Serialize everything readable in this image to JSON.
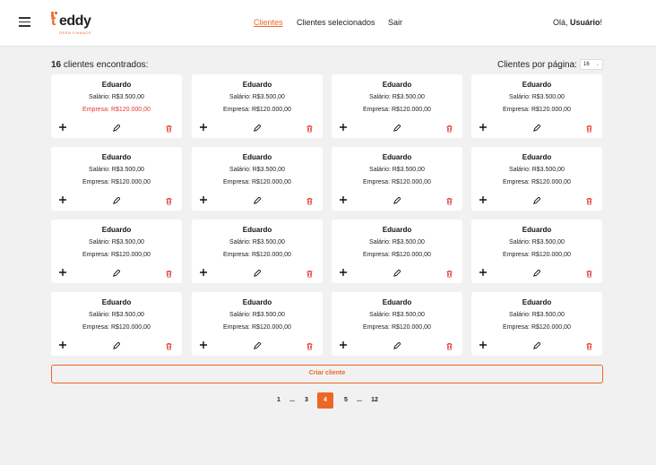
{
  "header": {
    "logo_text": "teddy",
    "logo_tagline": "OPEN FINANCE",
    "nav": [
      {
        "label": "Clientes",
        "active": true
      },
      {
        "label": "Clientes selecionados",
        "active": false
      },
      {
        "label": "Sair",
        "active": false
      }
    ],
    "greeting_prefix": "Olá, ",
    "greeting_user": "Usuário",
    "greeting_suffix": "!"
  },
  "summary": {
    "count": "16",
    "count_label": " clientes encontrados:",
    "per_page_label": "Clientes por página:",
    "per_page_value": "16"
  },
  "clients": [
    {
      "name": "Eduardo",
      "salary": "Salário: R$3.500,00",
      "company": "Empresa: R$120.000,00",
      "highlight": true
    },
    {
      "name": "Eduardo",
      "salary": "Salário: R$3.500,00",
      "company": "Empresa: R$120.000,00",
      "highlight": false
    },
    {
      "name": "Eduardo",
      "salary": "Salário: R$3.500,00",
      "company": "Empresa: R$120.000,00",
      "highlight": false
    },
    {
      "name": "Eduardo",
      "salary": "Salário: R$3.500,00",
      "company": "Empresa: R$120.000,00",
      "highlight": false
    },
    {
      "name": "Eduardo",
      "salary": "Salário: R$3.500,00",
      "company": "Empresa: R$120.000,00",
      "highlight": false
    },
    {
      "name": "Eduardo",
      "salary": "Salário: R$3.500,00",
      "company": "Empresa: R$120.000,00",
      "highlight": false
    },
    {
      "name": "Eduardo",
      "salary": "Salário: R$3.500,00",
      "company": "Empresa: R$120.000,00",
      "highlight": false
    },
    {
      "name": "Eduardo",
      "salary": "Salário: R$3.500,00",
      "company": "Empresa: R$120.000,00",
      "highlight": false
    },
    {
      "name": "Eduardo",
      "salary": "Salário: R$3.500,00",
      "company": "Empresa: R$120.000,00",
      "highlight": false
    },
    {
      "name": "Eduardo",
      "salary": "Salário: R$3.500,00",
      "company": "Empresa: R$120.000,00",
      "highlight": false
    },
    {
      "name": "Eduardo",
      "salary": "Salário: R$3.500,00",
      "company": "Empresa: R$120.000,00",
      "highlight": false
    },
    {
      "name": "Eduardo",
      "salary": "Salário: R$3.500,00",
      "company": "Empresa: R$120.000,00",
      "highlight": false
    },
    {
      "name": "Eduardo",
      "salary": "Salário: R$3.500,00",
      "company": "Empresa: R$120.000,00",
      "highlight": false
    },
    {
      "name": "Eduardo",
      "salary": "Salário: R$3.500,00",
      "company": "Empresa: R$120.000,00",
      "highlight": false
    },
    {
      "name": "Eduardo",
      "salary": "Salário: R$3.500,00",
      "company": "Empresa: R$120.000,00",
      "highlight": false
    },
    {
      "name": "Eduardo",
      "salary": "Salário: R$3.500,00",
      "company": "Empresa: R$120.000,00",
      "highlight": false
    }
  ],
  "card_icons": {
    "add": "plus-icon",
    "edit": "pencil-icon",
    "delete": "trash-icon"
  },
  "create_button": "Criar cliente",
  "pagination": [
    {
      "label": "1",
      "active": false
    },
    {
      "label": "...",
      "active": false
    },
    {
      "label": "3",
      "active": false
    },
    {
      "label": "4",
      "active": true
    },
    {
      "label": "5",
      "active": false
    },
    {
      "label": "...",
      "active": false
    },
    {
      "label": "12",
      "active": false
    }
  ],
  "colors": {
    "accent": "#ec6724",
    "danger": "#e53935"
  }
}
